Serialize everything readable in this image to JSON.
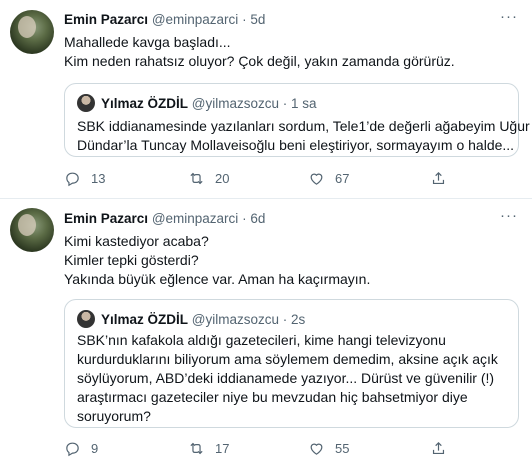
{
  "tweets": [
    {
      "author_name": "Emin Pazarcı",
      "handle": "@eminpazarci",
      "sep": "·",
      "time": "5d",
      "more": "···",
      "lines": [
        "Mahallede kavga başladı...",
        "Kim neden rahatsız oluyor? Çok değil, yakın zamanda görürüz."
      ],
      "quote": {
        "author_name": "Yılmaz ÖZDİL",
        "handle": "@yilmazsozcu",
        "sep": "·",
        "time": "1 sa",
        "lines": [
          "SBK iddianamesinde yazılanları sordum, Tele1’de değerli ağabeyim Uğur",
          "Dündar’la Tuncay Mollaveisoğlu beni eleştiriyor, sormayayım o halde..."
        ]
      },
      "actions": {
        "reply_count": "13",
        "retweet_count": "20",
        "like_count": "67"
      }
    },
    {
      "author_name": "Emin Pazarcı",
      "handle": "@eminpazarci",
      "sep": "·",
      "time": "6d",
      "more": "···",
      "lines": [
        "Kimi kastediyor acaba?",
        "Kimler tepki gösterdi?",
        "Yakında büyük eğlence var. Aman ha kaçırmayın."
      ],
      "quote": {
        "author_name": "Yılmaz ÖZDİL",
        "handle": "@yilmazsozcu",
        "sep": "·",
        "time": "2s",
        "lines": [
          "SBK’nın kafakola aldığı gazetecileri, kime hangi televizyonu",
          "kurdurduklarını biliyorum ama söylemem demedim, aksine açık açık",
          "söylüyorum, ABD’deki iddianamede yazıyor... Dürüst ve güvenilir (!)",
          "araştırmacı gazeteciler niye bu mevzudan hiç bahsetmiyor diye",
          "soruyorum?"
        ]
      },
      "actions": {
        "reply_count": "9",
        "retweet_count": "17",
        "like_count": "55"
      }
    }
  ],
  "icons": {
    "reply": "reply-icon",
    "retweet": "retweet-icon",
    "like": "heart-icon",
    "share": "share-icon",
    "more": "more-icon"
  }
}
